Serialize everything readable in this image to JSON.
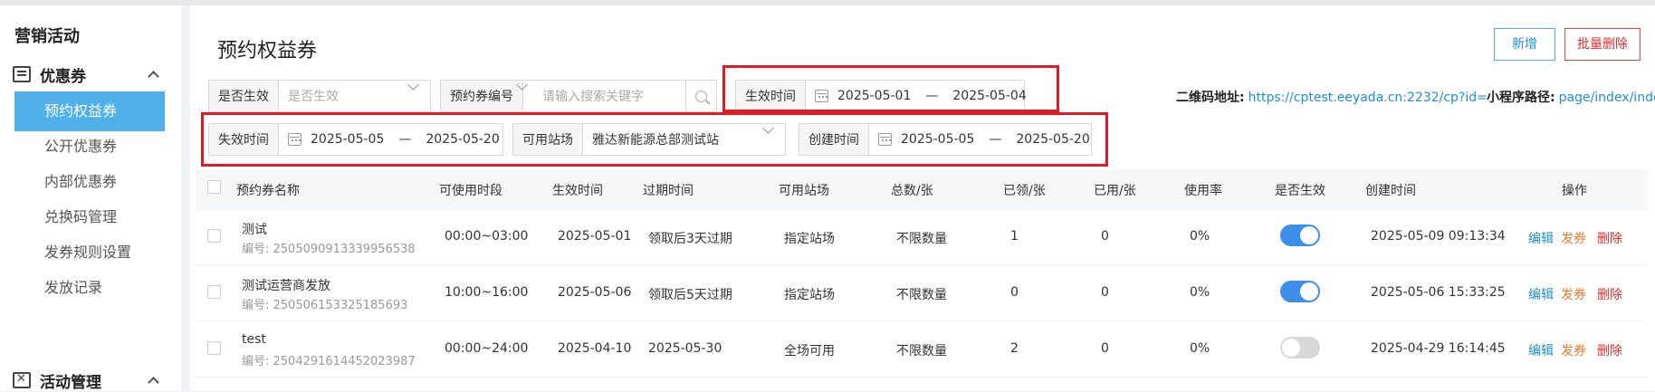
{
  "sidebar": {
    "title": "营销活动",
    "groups": [
      {
        "label": "优惠券",
        "icon": "coupon-icon"
      },
      {
        "label": "活动管理",
        "icon": "activity-icon"
      }
    ],
    "items": [
      "预约权益券",
      "公开优惠券",
      "内部优惠券",
      "兑换码管理",
      "发券规则设置",
      "发放记录"
    ],
    "active_item": "预约权益券",
    "accent_color": "#4fb0ea"
  },
  "page": {
    "title": "预约权益券",
    "add_label": "新增",
    "batch_delete_label": "批量删除"
  },
  "filters": {
    "status": {
      "label": "是否生效",
      "placeholder": "是否生效"
    },
    "code": {
      "label": "预约券编号",
      "placeholder": "请输入搜索关键字"
    },
    "effective": {
      "label": "生效时间",
      "start": "2025-05-01",
      "sep": "—",
      "end": "2025-05-04"
    },
    "expire": {
      "label": "失效时间",
      "start": "2025-05-05",
      "sep": "—",
      "end": "2025-05-20"
    },
    "station": {
      "label": "可用站场",
      "value": "雅达新能源总部测试站"
    },
    "created": {
      "label": "创建时间",
      "start": "2025-05-05",
      "sep": "—",
      "end": "2025-05-20"
    }
  },
  "links": {
    "qr_label": "二维码地址:",
    "qr_url": "https://cptest.eeyada.cn:2232/cp?id=",
    "mini_label": "小程序路径:",
    "mini_path": "page/index/index"
  },
  "table": {
    "columns": [
      "预约券名称",
      "可使用时段",
      "生效时间",
      "过期时间",
      "可用站场",
      "总数/张",
      "已领/张",
      "已用/张",
      "使用率",
      "是否生效",
      "创建时间",
      "操作"
    ],
    "rows": [
      {
        "name": "测试",
        "code": "编号: 2505090913339956538",
        "period": "00:00~03:00",
        "effective": "2025-05-01",
        "expire": "领取后3天过期",
        "station": "指定站场",
        "total": "不限数量",
        "claimed": "1",
        "used": "0",
        "rate": "0%",
        "enabled": true,
        "created": "2025-05-09 09:13:34"
      },
      {
        "name": "测试运营商发放",
        "code": "编号: 2505061533251856​93",
        "period": "10:00~16:00",
        "effective": "2025-05-06",
        "expire": "领取后5天过期",
        "station": "指定站场",
        "total": "不限数量",
        "claimed": "0",
        "used": "0",
        "rate": "0%",
        "enabled": true,
        "created": "2025-05-06 15:33:25"
      },
      {
        "name": "test",
        "code": "编号: 2504291614452023987",
        "period": "00:00~24:00",
        "effective": "2025-04-10",
        "expire": "2025-05-30",
        "station": "全场可用",
        "total": "不限数量",
        "claimed": "2",
        "used": "0",
        "rate": "0%",
        "enabled": false,
        "created": "2025-04-29 16:14:45"
      }
    ],
    "actions": {
      "edit": "编辑",
      "issue": "发券",
      "delete": "删除"
    }
  },
  "colors": {
    "highlight_box": "#e01b24",
    "toggle_on": "#3d8ee8",
    "toggle_off": "#d8d8d8"
  }
}
